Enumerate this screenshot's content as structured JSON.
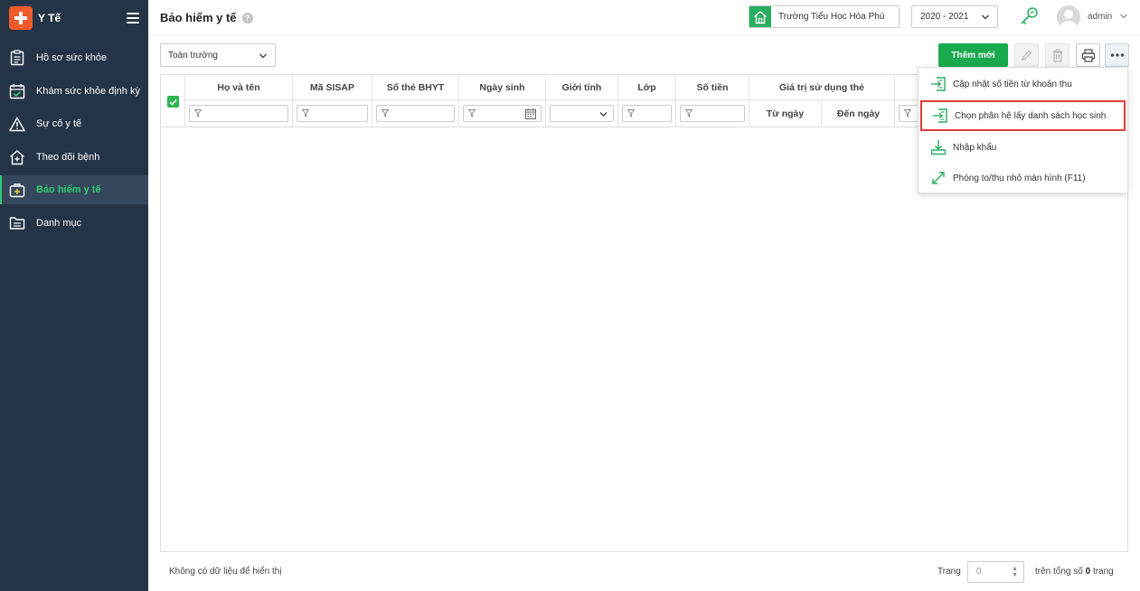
{
  "sidebar": {
    "app_name": "Y Tế",
    "items": [
      {
        "label": "Hồ sơ sức khỏe",
        "icon": "clipboard-icon"
      },
      {
        "label": "Khám sức khỏe định kỳ",
        "icon": "calendar-check-icon"
      },
      {
        "label": "Sự cố y tế",
        "icon": "warning-icon"
      },
      {
        "label": "Theo dõi bệnh",
        "icon": "home-plus-icon"
      },
      {
        "label": "Bảo hiểm y tế",
        "icon": "medical-bag-icon",
        "active": true
      },
      {
        "label": "Danh mục",
        "icon": "folder-list-icon"
      }
    ]
  },
  "header": {
    "title": "Bảo hiểm y tế",
    "help": "?",
    "school": "Trường Tiểu Học Hòa Phú",
    "year": "2020 - 2021",
    "user": "admin"
  },
  "toolbar": {
    "scope": "Toàn trường",
    "add_label": "Thêm mới"
  },
  "grid": {
    "columns": [
      "Họ và tên",
      "Mã SISAP",
      "Số thẻ BHYT",
      "Ngày sinh",
      "Giới tính",
      "Lớp",
      "Số tiền"
    ],
    "group_header": "Giá trị sử dụng thẻ",
    "sub_columns": [
      "Từ ngày",
      "Đến ngày"
    ]
  },
  "menu": {
    "items": [
      {
        "label": "Cập nhật số tiền từ khoản thu",
        "icon": "import-arrow-icon"
      },
      {
        "label": "Chọn phân hệ lấy danh sách học sinh",
        "icon": "import-arrow-icon",
        "highlight": true
      },
      {
        "label": "Nhập khẩu",
        "icon": "download-icon"
      },
      {
        "label": "Phóng to/thu nhỏ màn hình (F11)",
        "icon": "expand-icon"
      }
    ]
  },
  "footer": {
    "empty_text": "Không có dữ liệu để hiển thị",
    "page_label": "Trang",
    "page_value": "0",
    "total_prefix": "trên tổng số",
    "total_pages": "0",
    "total_suffix": "trang"
  },
  "colors": {
    "sidebar_bg": "#243447",
    "accent_green": "#1aa94c",
    "active_text": "#2ecc71",
    "brand_orange": "#ef5b2b",
    "highlight_red": "#e03c3c"
  }
}
